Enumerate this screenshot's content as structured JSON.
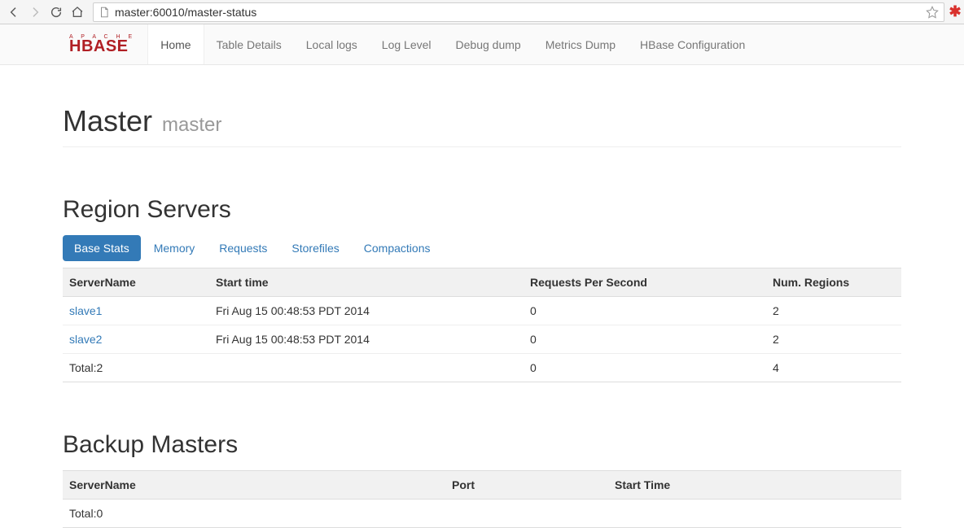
{
  "browser": {
    "url": "master:60010/master-status"
  },
  "nav": {
    "brand_top": "A P A C H E",
    "brand_main": "HBASE",
    "items": [
      {
        "label": "Home",
        "active": true
      },
      {
        "label": "Table Details",
        "active": false
      },
      {
        "label": "Local logs",
        "active": false
      },
      {
        "label": "Log Level",
        "active": false
      },
      {
        "label": "Debug dump",
        "active": false
      },
      {
        "label": "Metrics Dump",
        "active": false
      },
      {
        "label": "HBase Configuration",
        "active": false
      }
    ]
  },
  "header": {
    "title": "Master",
    "subtitle": "master"
  },
  "region_servers": {
    "heading": "Region Servers",
    "tabs": [
      {
        "label": "Base Stats",
        "active": true
      },
      {
        "label": "Memory",
        "active": false
      },
      {
        "label": "Requests",
        "active": false
      },
      {
        "label": "Storefiles",
        "active": false
      },
      {
        "label": "Compactions",
        "active": false
      }
    ],
    "columns": [
      "ServerName",
      "Start time",
      "Requests Per Second",
      "Num. Regions"
    ],
    "rows": [
      {
        "server": "slave1",
        "start": "Fri Aug 15 00:48:53 PDT 2014",
        "rps": "0",
        "regions": "2"
      },
      {
        "server": "slave2",
        "start": "Fri Aug 15 00:48:53 PDT 2014",
        "rps": "0",
        "regions": "2"
      }
    ],
    "footer": {
      "total": "Total:2",
      "rps": "0",
      "regions": "4"
    }
  },
  "backup_masters": {
    "heading": "Backup Masters",
    "columns": [
      "ServerName",
      "Port",
      "Start Time"
    ],
    "footer": {
      "total": "Total:0"
    }
  }
}
